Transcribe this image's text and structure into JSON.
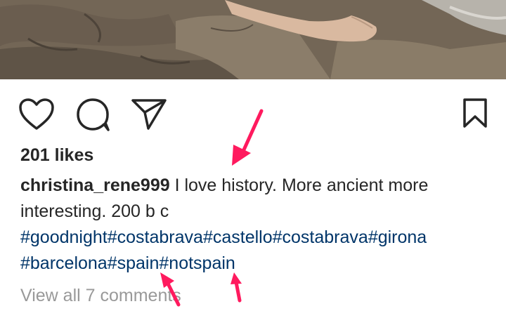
{
  "post": {
    "likes": "201 likes",
    "username": "christina_rene999",
    "caption_text": " I love history. More ancient more interesting. 200 b c",
    "hashtags": [
      "#goodnight",
      "#costabrava",
      "#castello",
      "#costabrava",
      "#girona",
      "#barcelona",
      "#spain",
      "#notspain"
    ],
    "view_comments": "View all 7 comments"
  },
  "icons": {
    "like": "heart-outline-icon",
    "comment": "speech-bubble-icon",
    "share": "paper-plane-icon",
    "save": "bookmark-outline-icon"
  },
  "colors": {
    "text": "#262626",
    "hashtag": "#003569",
    "muted": "#999999",
    "annotation_arrow": "#ff1a5e"
  }
}
